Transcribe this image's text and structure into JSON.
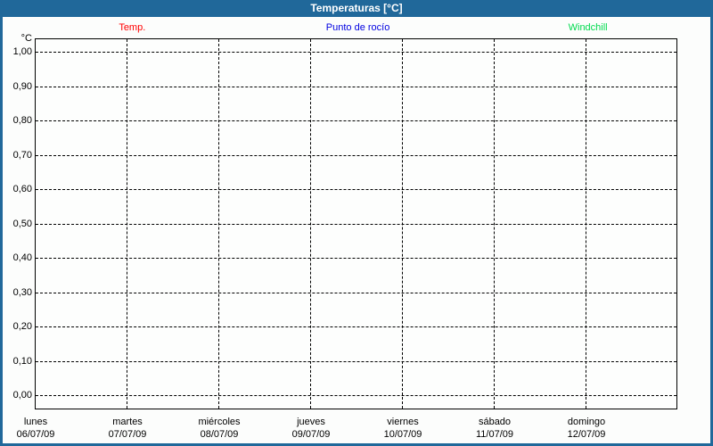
{
  "title_bar": {
    "title": "Temperaturas [°C]"
  },
  "legend": {
    "items": [
      {
        "label": "Temp.",
        "color": "#ff0000"
      },
      {
        "label": "Punto de rocío",
        "color": "#0000e0"
      },
      {
        "label": "Windchill",
        "color": "#00da4e"
      }
    ]
  },
  "colors": {
    "frame": "#20689a",
    "titlebar_text": "#ffffff",
    "grid": "#000000",
    "plot_background": "#fdfefd",
    "page_background": "#fcfdfc"
  },
  "chart_data": {
    "type": "line",
    "title": "Temperaturas [°C]",
    "ylabel": "°C",
    "xlabel": "",
    "ylim": [
      0.0,
      1.0
    ],
    "y_tick_step": 0.1,
    "y_tick_labels": [
      "1,00",
      "0,90",
      "0,80",
      "0,70",
      "0,60",
      "0,50",
      "0,40",
      "0,30",
      "0,20",
      "0,10",
      "0,00"
    ],
    "x_categories": [
      {
        "day": "lunes",
        "date": "06/07/09"
      },
      {
        "day": "martes",
        "date": "07/07/09"
      },
      {
        "day": "miércoles",
        "date": "08/07/09"
      },
      {
        "day": "jueves",
        "date": "09/07/09"
      },
      {
        "day": "viernes",
        "date": "10/07/09"
      },
      {
        "day": "sábado",
        "date": "11/07/09"
      },
      {
        "day": "domingo",
        "date": "12/07/09"
      }
    ],
    "grid": "dashed",
    "legend_position": "top",
    "series": [
      {
        "name": "Temp.",
        "color": "#ff0000",
        "values": []
      },
      {
        "name": "Punto de rocío",
        "color": "#0000e0",
        "values": []
      },
      {
        "name": "Windchill",
        "color": "#00da4e",
        "values": []
      }
    ]
  }
}
